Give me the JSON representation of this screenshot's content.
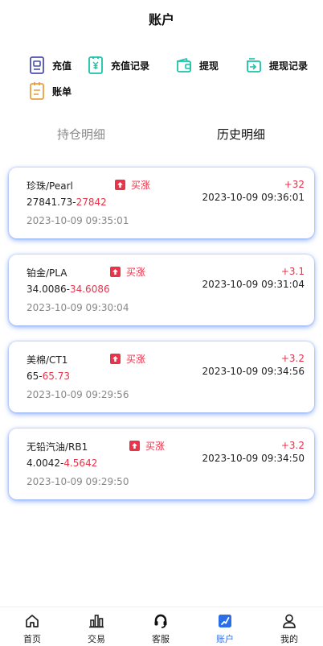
{
  "header": {
    "title": "账户"
  },
  "actions": [
    {
      "label": "充值",
      "icon": "wallet-icon"
    },
    {
      "label": "充值记录",
      "icon": "recharge-record-icon"
    },
    {
      "label": "提现",
      "icon": "withdraw-icon"
    },
    {
      "label": "提现记录",
      "icon": "withdraw-record-icon"
    },
    {
      "label": "账单",
      "icon": "bill-icon"
    }
  ],
  "tabs": [
    {
      "label": "持仓明细",
      "active": false
    },
    {
      "label": "历史明细",
      "active": true
    }
  ],
  "trades": [
    {
      "name": "珍珠/Pearl",
      "direction": "买涨",
      "open_price": "27841.73",
      "separator": "-",
      "close_price": "27842",
      "open_time": "2023-10-09 09:35:01",
      "profit": "+32",
      "close_time": "2023-10-09 09:36:01"
    },
    {
      "name": "铂金/PLA",
      "direction": "买涨",
      "open_price": "34.0086",
      "separator": "-",
      "close_price": "34.6086",
      "open_time": "2023-10-09 09:30:04",
      "profit": "+3.1",
      "close_time": "2023-10-09 09:31:04"
    },
    {
      "name": "美棉/CT1",
      "direction": "买涨",
      "open_price": "65",
      "separator": "-",
      "close_price": "65.73",
      "open_time": "2023-10-09 09:29:56",
      "profit": "+3.2",
      "close_time": "2023-10-09 09:34:56"
    },
    {
      "name": "无铅汽油/RB1",
      "direction": "买涨",
      "open_price": "4.0042",
      "separator": "-",
      "close_price": "4.5642",
      "open_time": "2023-10-09 09:29:50",
      "profit": "+3.2",
      "close_time": "2023-10-09 09:34:50"
    }
  ],
  "nav": [
    {
      "label": "首页",
      "icon": "home-icon",
      "active": false
    },
    {
      "label": "交易",
      "icon": "chart-icon",
      "active": false
    },
    {
      "label": "客服",
      "icon": "headset-icon",
      "active": false
    },
    {
      "label": "账户",
      "icon": "account-icon",
      "active": true
    },
    {
      "label": "我的",
      "icon": "user-icon",
      "active": false
    }
  ],
  "colors": {
    "accent": "#2a6ee8",
    "rise": "#e8334a",
    "action_icon": "#19c3a8",
    "bill_icon": "#e8a046"
  }
}
